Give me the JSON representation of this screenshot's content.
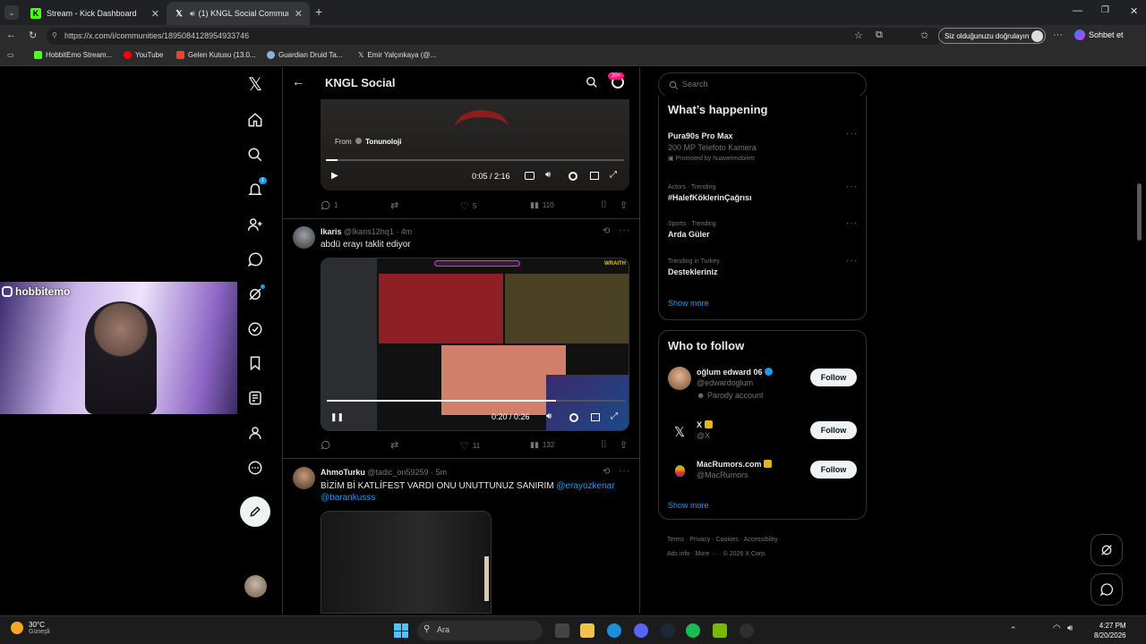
{
  "browser": {
    "tabs": [
      {
        "title": "Stream - Kick Dashboard"
      },
      {
        "title": "(1) KNGL Social Community /"
      }
    ],
    "url": "https://x.com/i/communities/1895084128954933746",
    "verify_button": "Siz olduğunuzu doğrulayın",
    "copilot_label": "Sohbet et",
    "bookmarks": [
      "HobbitEmo Stream...",
      "YouTube",
      "Gelen Kutusu (13.0...",
      "Guardian Druid Ta...",
      "Emir Yalçınkaya (@..."
    ]
  },
  "header": {
    "title": "KNGL Social",
    "badge": "20+"
  },
  "sidebar": {
    "notification_count": "1"
  },
  "video1": {
    "from_label": "From",
    "from_source": "Tonunoloji",
    "time": "0:05 / 2:16",
    "progress": 0.04
  },
  "tweet1_actions": {
    "replies": "1",
    "likes": "5",
    "views": "110"
  },
  "tweet2": {
    "name": "Ikaris",
    "handle": "@Ikaris12hq1",
    "time": "· 4m",
    "text": "abdü erayı taklit ediyor",
    "video_time": "0:20 / 0:26",
    "progress": 0.77,
    "video_banner": "WRAITH",
    "replies": "",
    "likes": "11",
    "views": "132"
  },
  "tweet3": {
    "name": "AhmoTurku",
    "handle": "@tadic_on59259",
    "time": "· 5m",
    "text": "BİZİM Bİ KATLİFEST VARDI ONU UNUTTUNUZ SANIRIM",
    "mention1": "@erayozkenar",
    "mention2": "@barankusss"
  },
  "webcam": {
    "label": "hobbitemo"
  },
  "search": {
    "placeholder": "Search"
  },
  "whats_happening": {
    "title": "What’s happening",
    "items": [
      {
        "meta": "",
        "title": "Pura90s Pro Max",
        "sub": "200 MP Telefoto Kamera",
        "promo": "Promoted by huaweimobiletr"
      },
      {
        "meta": "Actors · Trending",
        "title": "#HalefKöklerinÇağrısı"
      },
      {
        "meta": "Sports · Trending",
        "title": "Arda Güler"
      },
      {
        "meta": "Trending in Turkey",
        "title": "Destekleriniz"
      }
    ],
    "show_more": "Show more"
  },
  "who_to_follow": {
    "title": "Who to follow",
    "users": [
      {
        "name": "oğlum edward 06",
        "handle": "@edwardoglum",
        "note": "Parody account",
        "button": "Follow"
      },
      {
        "name": "X",
        "handle": "@X",
        "button": "Follow"
      },
      {
        "name": "MacRumors.com",
        "handle": "@MacRumors",
        "button": "Follow"
      }
    ],
    "show_more": "Show more"
  },
  "footer": {
    "links": [
      "Terms",
      "Privacy",
      "Cookies",
      "Accessibility",
      "Ads info",
      "More ···",
      "© 2026 X Corp."
    ]
  },
  "taskbar": {
    "weather_temp": "30°C",
    "weather_desc": "Güneşli",
    "search_placeholder": "Ara",
    "time": "4:27 PM",
    "date": "8/20/2026"
  },
  "colors": {
    "accent": "#1d9bf0",
    "badge": "#f91880",
    "kick": "#53fc18"
  }
}
